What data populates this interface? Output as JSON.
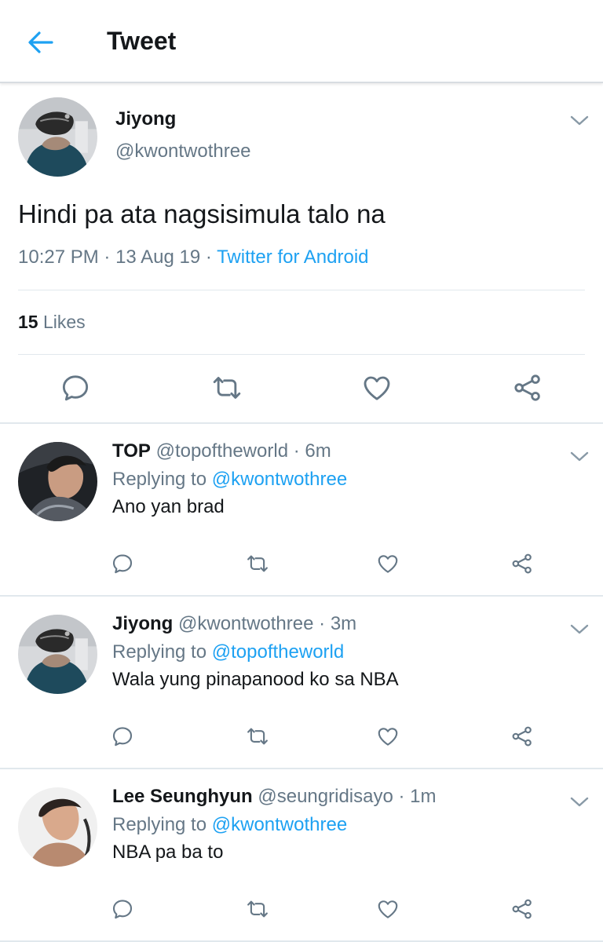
{
  "header": {
    "title": "Tweet"
  },
  "tweet": {
    "name": "Jiyong",
    "handle": "@kwontwothree",
    "text": "Hindi pa ata nagsisimula talo na",
    "time": "10:27 PM",
    "date": "13 Aug 19",
    "source": "Twitter for Android",
    "likes_count": "15",
    "likes_label": "Likes"
  },
  "replies": [
    {
      "name": "TOP",
      "handle": "@topoftheworld",
      "time": "6m",
      "replying_label": "Replying to",
      "replying_to": "@kwontwothree",
      "text": "Ano yan brad"
    },
    {
      "name": "Jiyong",
      "handle": "@kwontwothree",
      "time": "3m",
      "replying_label": "Replying to",
      "replying_to": "@topoftheworld",
      "text": "Wala yung pinapanood ko sa NBA"
    },
    {
      "name": "Lee Seunghyun",
      "handle": "@seungridisayo",
      "time": "1m",
      "replying_label": "Replying to",
      "replying_to": "@kwontwothree",
      "text": "NBA pa ba to"
    }
  ],
  "separator": "·",
  "icons": [
    "back-arrow-icon",
    "chevron-down-icon",
    "reply-icon",
    "retweet-icon",
    "like-heart-icon",
    "share-icon"
  ],
  "colors": {
    "accent": "#1da1f2",
    "text": "#14171a",
    "secondary": "#657786",
    "divider": "#e1e8ed",
    "icon": "#657786"
  }
}
